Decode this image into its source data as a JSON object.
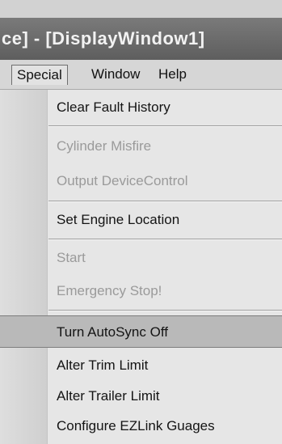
{
  "window": {
    "title": "ce] - [DisplayWindow1]"
  },
  "menubar": {
    "special": "Special",
    "window": "Window",
    "help": "Help"
  },
  "dropdown": {
    "items": [
      {
        "label": "Clear Fault History",
        "enabled": true
      },
      {
        "label": "Cylinder Misfire",
        "enabled": false
      },
      {
        "label": "Output DeviceControl",
        "enabled": false
      },
      {
        "label": "Set Engine Location",
        "enabled": true
      },
      {
        "label": "Start",
        "enabled": false
      },
      {
        "label": "Emergency Stop!",
        "enabled": false
      },
      {
        "label": "Turn AutoSync Off",
        "enabled": true,
        "highlighted": true
      },
      {
        "label": "Alter Trim Limit",
        "enabled": true
      },
      {
        "label": "Alter Trailer Limit",
        "enabled": true
      },
      {
        "label": "Configure EZLink Guages",
        "enabled": true
      }
    ]
  }
}
